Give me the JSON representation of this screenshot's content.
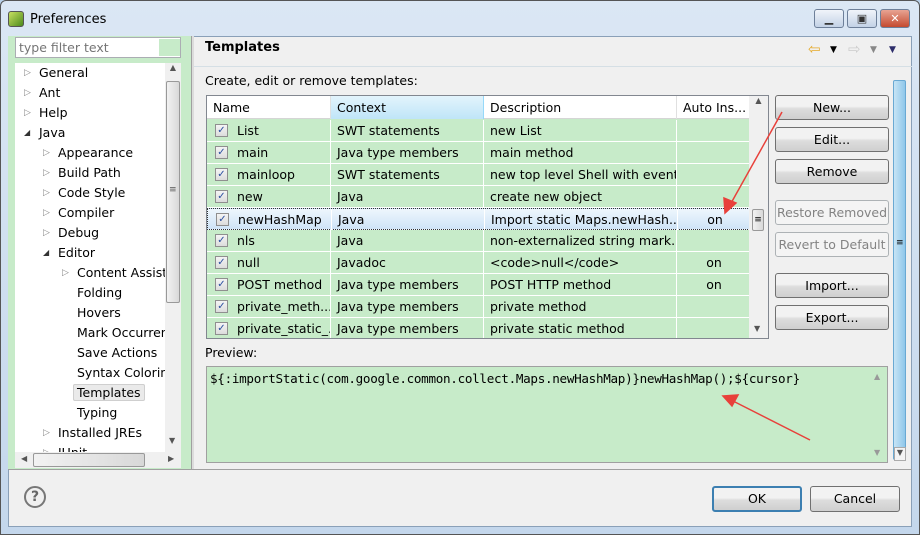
{
  "window": {
    "title": "Preferences",
    "icon": "eclipse-leaf-icon",
    "controls": [
      "minimize",
      "maximize",
      "close"
    ]
  },
  "sidebar": {
    "filter_placeholder": "type filter text",
    "items": [
      {
        "label": "General",
        "level": 0,
        "expander": "collapsed"
      },
      {
        "label": "Ant",
        "level": 0,
        "expander": "collapsed"
      },
      {
        "label": "Help",
        "level": 0,
        "expander": "collapsed"
      },
      {
        "label": "Java",
        "level": 0,
        "expander": "expanded"
      },
      {
        "label": "Appearance",
        "level": 1,
        "expander": "collapsed"
      },
      {
        "label": "Build Path",
        "level": 1,
        "expander": "collapsed"
      },
      {
        "label": "Code Style",
        "level": 1,
        "expander": "collapsed"
      },
      {
        "label": "Compiler",
        "level": 1,
        "expander": "collapsed"
      },
      {
        "label": "Debug",
        "level": 1,
        "expander": "collapsed"
      },
      {
        "label": "Editor",
        "level": 1,
        "expander": "expanded"
      },
      {
        "label": "Content Assist",
        "level": 2,
        "expander": "collapsed"
      },
      {
        "label": "Folding",
        "level": 2,
        "expander": "none"
      },
      {
        "label": "Hovers",
        "level": 2,
        "expander": "none"
      },
      {
        "label": "Mark Occurren",
        "level": 2,
        "expander": "none"
      },
      {
        "label": "Save Actions",
        "level": 2,
        "expander": "none"
      },
      {
        "label": "Syntax Coloring",
        "level": 2,
        "expander": "none"
      },
      {
        "label": "Templates",
        "level": 2,
        "expander": "none",
        "selected": true
      },
      {
        "label": "Typing",
        "level": 2,
        "expander": "none"
      },
      {
        "label": "Installed JREs",
        "level": 1,
        "expander": "collapsed"
      },
      {
        "label": "JUnit",
        "level": 1,
        "expander": "collapsed"
      }
    ]
  },
  "page": {
    "title": "Templates",
    "description": "Create, edit or remove templates:",
    "nav_icons": [
      "back-arrow-icon",
      "forward-arrow-icon",
      "view-menu-icon"
    ],
    "table": {
      "columns": [
        "Name",
        "Context",
        "Description",
        "Auto Ins..."
      ],
      "rows": [
        {
          "checked": true,
          "name": "List",
          "context": "SWT statements",
          "description": "new List",
          "auto": ""
        },
        {
          "checked": true,
          "name": "main",
          "context": "Java type members",
          "description": "main method",
          "auto": ""
        },
        {
          "checked": true,
          "name": "mainloop",
          "context": "SWT statements",
          "description": "new top level Shell with event...",
          "auto": ""
        },
        {
          "checked": true,
          "name": "new",
          "context": "Java",
          "description": "create new object",
          "auto": ""
        },
        {
          "checked": true,
          "name": "newHashMap",
          "context": "Java",
          "description": "Import static Maps.newHash...",
          "auto": "on",
          "selected": true
        },
        {
          "checked": true,
          "name": "nls",
          "context": "Java",
          "description": "non-externalized string mark...",
          "auto": ""
        },
        {
          "checked": true,
          "name": "null",
          "context": "Javadoc",
          "description": "<code>null</code>",
          "auto": "on"
        },
        {
          "checked": true,
          "name": "POST method",
          "context": "Java type members",
          "description": "POST HTTP method",
          "auto": "on"
        },
        {
          "checked": true,
          "name": "private_meth...",
          "context": "Java type members",
          "description": "private method",
          "auto": ""
        },
        {
          "checked": true,
          "name": "private_static_...",
          "context": "Java type members",
          "description": "private static method",
          "auto": ""
        }
      ]
    },
    "buttons": {
      "new": "New...",
      "edit": "Edit...",
      "remove": "Remove",
      "restore": "Restore Removed",
      "revert": "Revert to Default",
      "import": "Import...",
      "export": "Export..."
    },
    "preview_label": "Preview:",
    "preview_text": "${:importStatic(com.google.common.collect.Maps.newHashMap)}newHashMap();${cursor}"
  },
  "footer": {
    "ok": "OK",
    "cancel": "Cancel",
    "help_icon": "help-icon"
  },
  "colors": {
    "panel_green": "#c7ebc9",
    "annotation_arrow": "#e8403a"
  }
}
